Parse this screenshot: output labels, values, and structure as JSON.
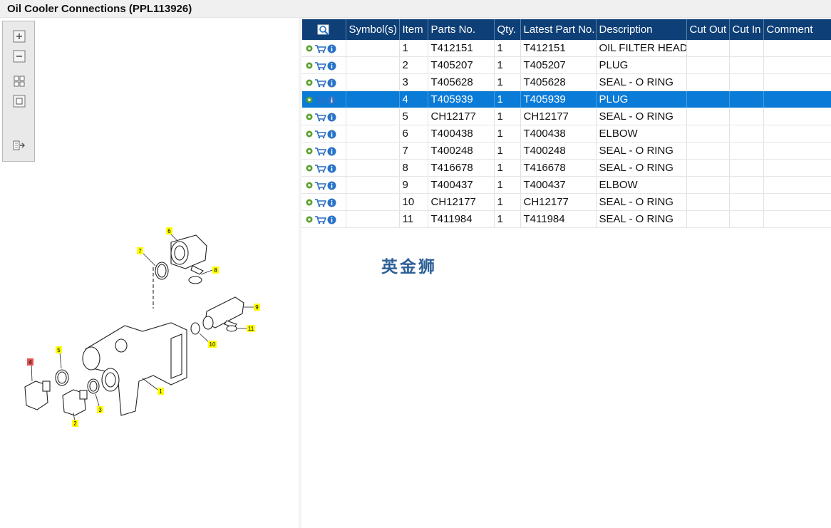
{
  "window": {
    "title": "Oil Cooler Connections (PPL113926)"
  },
  "toolbar": {
    "buttons": [
      "zoom-in-icon",
      "zoom-out-icon",
      "fit-all-icon",
      "fit-page-icon",
      "export-icon"
    ]
  },
  "table": {
    "columns": [
      "",
      "Symbol(s)",
      "Item",
      "Parts No.",
      "Qty.",
      "Latest Part No.",
      "Description",
      "Cut Out",
      "Cut In",
      "Comment"
    ],
    "selected_row": 3,
    "rows": [
      {
        "symbol": "",
        "item": "1",
        "part": "T412151",
        "qty": "1",
        "latest": "T412151",
        "desc": "OIL FILTER HEAD",
        "cutout": "",
        "cutin": "",
        "comment": ""
      },
      {
        "symbol": "",
        "item": "2",
        "part": "T405207",
        "qty": "1",
        "latest": "T405207",
        "desc": "PLUG",
        "cutout": "",
        "cutin": "",
        "comment": ""
      },
      {
        "symbol": "",
        "item": "3",
        "part": "T405628",
        "qty": "1",
        "latest": "T405628",
        "desc": "SEAL - O RING",
        "cutout": "",
        "cutin": "",
        "comment": ""
      },
      {
        "symbol": "",
        "item": "4",
        "part": "T405939",
        "qty": "1",
        "latest": "T405939",
        "desc": "PLUG",
        "cutout": "",
        "cutin": "",
        "comment": ""
      },
      {
        "symbol": "",
        "item": "5",
        "part": "CH12177",
        "qty": "1",
        "latest": "CH12177",
        "desc": "SEAL - O RING",
        "cutout": "",
        "cutin": "",
        "comment": ""
      },
      {
        "symbol": "",
        "item": "6",
        "part": "T400438",
        "qty": "1",
        "latest": "T400438",
        "desc": "ELBOW",
        "cutout": "",
        "cutin": "",
        "comment": ""
      },
      {
        "symbol": "",
        "item": "7",
        "part": "T400248",
        "qty": "1",
        "latest": "T400248",
        "desc": "SEAL - O RING",
        "cutout": "",
        "cutin": "",
        "comment": ""
      },
      {
        "symbol": "",
        "item": "8",
        "part": "T416678",
        "qty": "1",
        "latest": "T416678",
        "desc": "SEAL - O RING",
        "cutout": "",
        "cutin": "",
        "comment": ""
      },
      {
        "symbol": "",
        "item": "9",
        "part": "T400437",
        "qty": "1",
        "latest": "T400437",
        "desc": "ELBOW",
        "cutout": "",
        "cutin": "",
        "comment": ""
      },
      {
        "symbol": "",
        "item": "10",
        "part": "CH12177",
        "qty": "1",
        "latest": "CH12177",
        "desc": "SEAL - O RING",
        "cutout": "",
        "cutin": "",
        "comment": ""
      },
      {
        "symbol": "",
        "item": "11",
        "part": "T411984",
        "qty": "1",
        "latest": "T411984",
        "desc": "SEAL - O RING",
        "cutout": "",
        "cutin": "",
        "comment": ""
      }
    ]
  },
  "diagram": {
    "callouts": [
      "1",
      "2",
      "3",
      "4",
      "5",
      "6",
      "7",
      "8",
      "9",
      "10",
      "11"
    ],
    "highlighted_callout": "4"
  },
  "watermark": "英金狮",
  "colors": {
    "header_bg": "#0e3f77",
    "selected_row": "#0a7bd7",
    "callout": "#ffff00",
    "callout_highlight": "#e05555"
  }
}
